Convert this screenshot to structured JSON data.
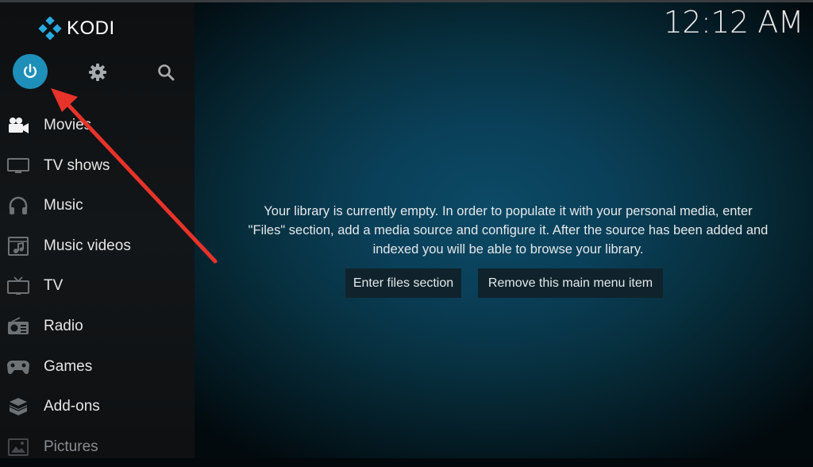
{
  "app": {
    "name": "KODI"
  },
  "header": {
    "clock": "12:12 AM"
  },
  "top_buttons": [
    {
      "name": "power",
      "icon": "power-icon",
      "accent": "#1e8fb8"
    },
    {
      "name": "settings",
      "icon": "gear-icon"
    },
    {
      "name": "search",
      "icon": "search-icon"
    }
  ],
  "sidebar": {
    "items": [
      {
        "label": "Movies",
        "icon": "movie-camera-icon"
      },
      {
        "label": "TV shows",
        "icon": "tv-icon"
      },
      {
        "label": "Music",
        "icon": "headphones-icon"
      },
      {
        "label": "Music videos",
        "icon": "music-video-icon"
      },
      {
        "label": "TV",
        "icon": "television-icon"
      },
      {
        "label": "Radio",
        "icon": "radio-icon"
      },
      {
        "label": "Games",
        "icon": "gamepad-icon"
      },
      {
        "label": "Add-ons",
        "icon": "addons-box-icon"
      },
      {
        "label": "Pictures",
        "icon": "pictures-icon"
      }
    ]
  },
  "main": {
    "message_lines": [
      "Your library is currently empty. In order to populate it with your personal media, enter",
      "\"Files\" section, add a media source and configure it. After the source has been added and",
      "indexed you will be able to browse your library."
    ],
    "buttons": {
      "enter_files": "Enter files section",
      "remove_item": "Remove this main menu item"
    }
  },
  "annotation": {
    "type": "red-arrow",
    "points_to": "power-button",
    "color": "#e8332a"
  }
}
